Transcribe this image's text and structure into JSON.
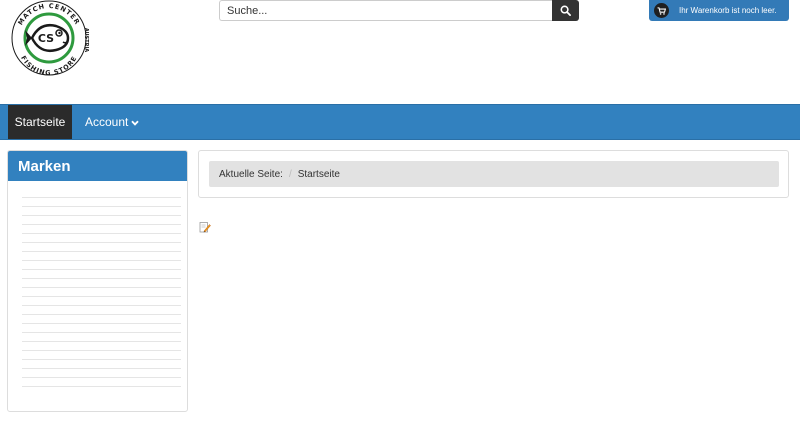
{
  "logo": {
    "ring_text_top": "MATCH CENTER",
    "ring_text_right": "AUSTRIA",
    "ring_text_bottom": "FISHING STORE",
    "fish_label": "CS",
    "ring_color": "#2e9a3e"
  },
  "search": {
    "placeholder": "Suche...",
    "button_icon": "search-icon"
  },
  "cart": {
    "label": "Ihr Warenkorb ist noch leer.",
    "icon": "cart-icon"
  },
  "nav": {
    "home": "Startseite",
    "account": "Account",
    "account_icon": "chevron-down-icon"
  },
  "sidebar": {
    "title": "Marken"
  },
  "breadcrumb": {
    "label": "Aktuelle Seite:",
    "separator": "/",
    "current": "Startseite"
  },
  "edit_icon": "edit-icon",
  "colors": {
    "primary": "#3281bf",
    "dark": "#2b2b2b",
    "crumb_bg": "#e2e2e2"
  }
}
